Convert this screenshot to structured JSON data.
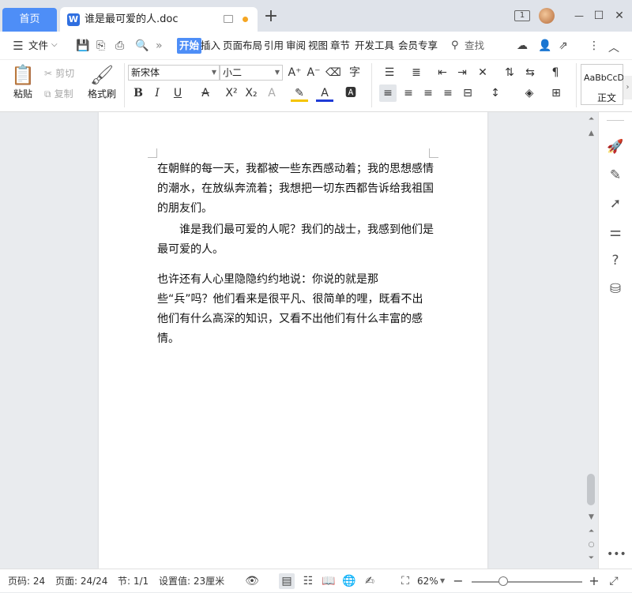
{
  "tabs": {
    "home_label": "首页",
    "doc_label": "谁是最可爱的人.doc",
    "doc_icon_letter": "W",
    "add_label": "+"
  },
  "window": {
    "badge": "1",
    "minimize": "—",
    "maximize": "☐",
    "close": "✕"
  },
  "menu": {
    "file_label": "文件",
    "items": [
      "开始",
      "插入",
      "页面布局",
      "引用",
      "审阅",
      "视图",
      "章节",
      "开发工具",
      "会员专享"
    ],
    "search_label": "查找"
  },
  "ribbon": {
    "paste_label": "粘贴",
    "cut_label": "剪切",
    "copy_label": "复制",
    "format_painter_label": "格式刷",
    "font_name": "新宋体",
    "font_size": "小二",
    "style_preview": "AaBbCcDd",
    "style_name": "正文"
  },
  "document": {
    "paragraphs": [
      "在朝鲜的每一天，我都被一些东西感动着；我的思想感情的潮水，在放纵奔流着；我想把一切东西都告诉给我祖国的朋友们。",
      "谁是我们最可爱的人呢？我们的战士，我感到他们是最可爱的人。",
      "也许还有人心里隐隐约约地说：你说的就是那些“兵”吗？他们看来是很平凡、很简单的哩，既看不出他们有什么高深的知识，又看不出他们有什么丰富的感情。"
    ]
  },
  "status": {
    "page_code": "页码: 24",
    "pages": "页面: 24/24",
    "section": "节: 1/1",
    "setting": "设置值: 23厘米",
    "zoom": "62%"
  },
  "colors": {
    "accent": "#4e8ef7",
    "font_color_bar": "#1f3bd6",
    "highlight_bar": "#f5c400",
    "modified_dot": "#f5a623"
  }
}
